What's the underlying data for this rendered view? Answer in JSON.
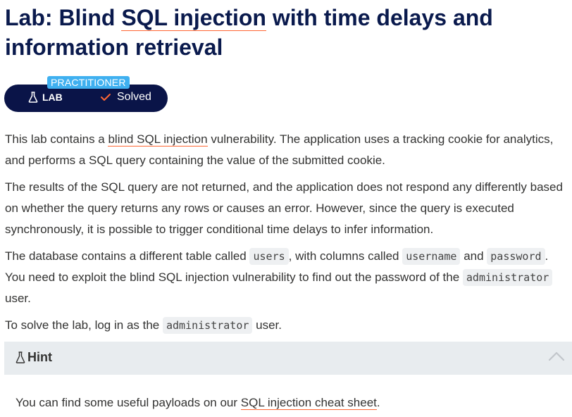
{
  "title": {
    "before": "Lab: Blind ",
    "link": "SQL injection",
    "after": " with time delays and information retrieval"
  },
  "badge": {
    "level": "PRACTITIONER",
    "type": "LAB",
    "status": "Solved"
  },
  "paragraphs": {
    "p1": {
      "before": "This lab contains a ",
      "link": "blind SQL injection",
      "after": " vulnerability. The application uses a tracking cookie for analytics, and performs a SQL query containing the value of the submitted cookie."
    },
    "p2": {
      "text": "The results of the SQL query are not returned, and the application does not respond any differently based on whether the query returns any rows or causes an error. However, since the query is executed synchronously, it is possible to trigger conditional time delays to infer information."
    },
    "p3": {
      "t1": "The database contains a different table called ",
      "code1": "users",
      "t2": ", with columns called ",
      "code2": "username",
      "t3": " and ",
      "code3": "password",
      "t4": ". You need to exploit the blind SQL injection vulnerability to find out the password of the ",
      "code4": "administrator",
      "t5": " user."
    },
    "p4": {
      "t1": "To solve the lab, log in as the ",
      "code1": "administrator",
      "t2": " user."
    }
  },
  "hint": {
    "label": "Hint",
    "body_before": "You can find some useful payloads on our ",
    "body_link": "SQL injection cheat sheet",
    "body_after": "."
  },
  "icons": {
    "lab": "flask-icon",
    "solved": "checkmark-icon",
    "hint": "flask-icon",
    "collapse": "chevron-up-icon"
  },
  "colors": {
    "navy": "#0a1448",
    "accent": "#ff6633",
    "badge_blue": "#3fb0f0",
    "hint_bg": "#e8ecef"
  }
}
